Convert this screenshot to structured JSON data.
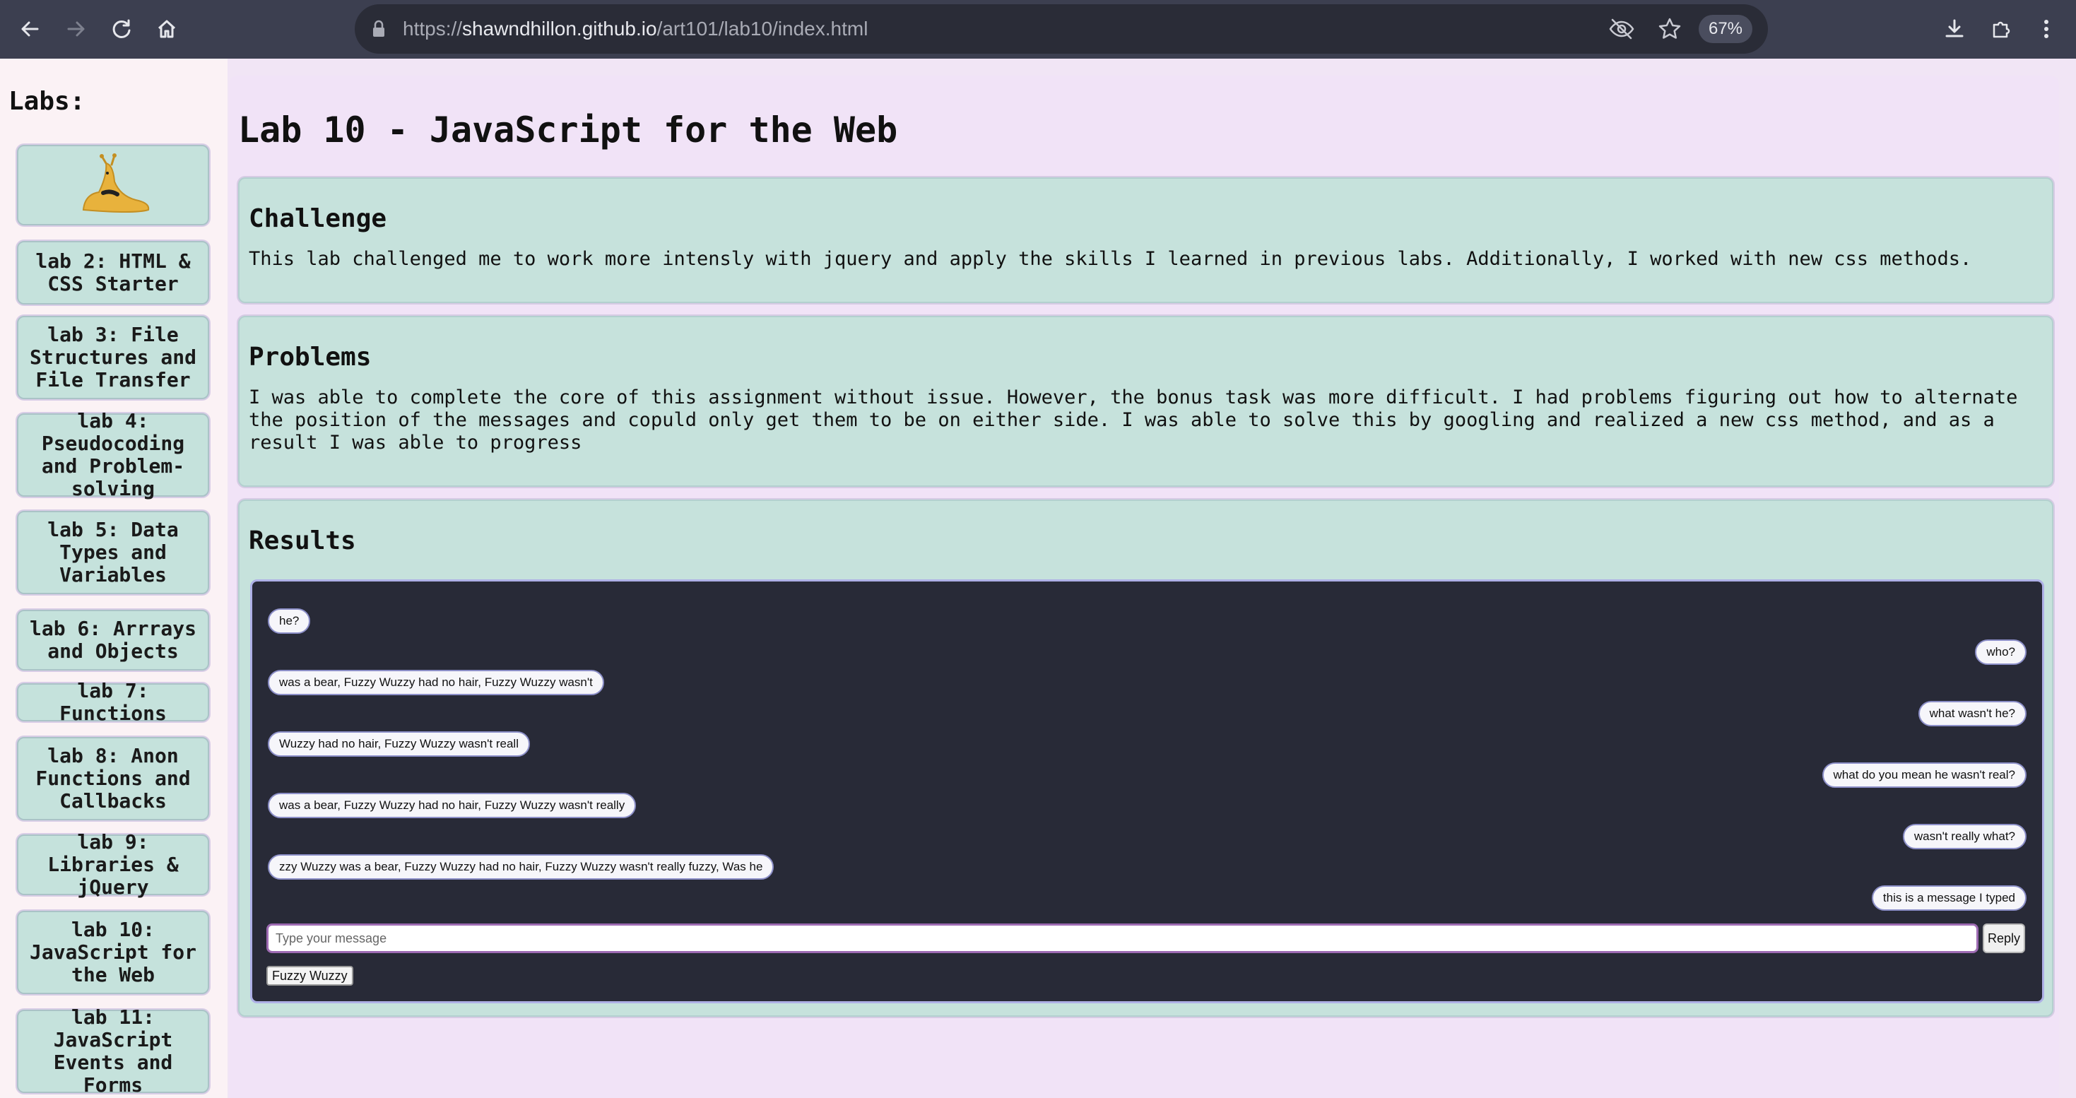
{
  "browser": {
    "url_scheme": "https://",
    "url_host": "shawndhillon.github.io",
    "url_path": "/art101/lab10/index.html",
    "zoom": "67%"
  },
  "sidebar": {
    "title": "Labs:",
    "items": [
      {
        "label": "",
        "icon": "banana-slug-mascot"
      },
      {
        "label": "lab 2: HTML & CSS Starter"
      },
      {
        "label": "lab 3: File Structures and File Transfer"
      },
      {
        "label": "lab 4: Pseudocoding and Problem-solving"
      },
      {
        "label": "lab 5: Data Types and Variables"
      },
      {
        "label": "lab 6: Arrrays and Objects"
      },
      {
        "label": "lab 7: Functions"
      },
      {
        "label": "lab 8: Anon Functions and Callbacks"
      },
      {
        "label": "lab 9: Libraries & jQuery"
      },
      {
        "label": "lab 10: JavaScript for the Web"
      },
      {
        "label": "lab 11: JavaScript Events and Forms"
      }
    ]
  },
  "main": {
    "title": "Lab 10 - JavaScript for the Web",
    "challenge": {
      "heading": "Challenge",
      "text": "This lab challenged me to work more intensly with jquery and apply the skills I learned in previous labs. Additionally, I worked with new css methods."
    },
    "problems": {
      "heading": "Problems",
      "text": "I was able to complete the core of this assignment without issue. However, the bonus task was more difficult. I had problems figuring out how to alternate the position of the messages and copuld only get them to be on either side. I was able to solve this by googling and realized a new css method, and as a result I was able to progress"
    },
    "results": {
      "heading": "Results",
      "messages": [
        {
          "side": "left",
          "text": "he?"
        },
        {
          "side": "right",
          "text": "who?"
        },
        {
          "side": "left",
          "text": "was a bear, Fuzzy Wuzzy had no hair, Fuzzy Wuzzy wasn't"
        },
        {
          "side": "right",
          "text": "what wasn't he?"
        },
        {
          "side": "left",
          "text": "Wuzzy had no hair, Fuzzy Wuzzy wasn't reall"
        },
        {
          "side": "right",
          "text": "what do you mean he wasn't real?"
        },
        {
          "side": "left",
          "text": "was a bear, Fuzzy Wuzzy had no hair, Fuzzy Wuzzy wasn't really"
        },
        {
          "side": "right",
          "text": "wasn't really what?"
        },
        {
          "side": "left",
          "text": "zzy Wuzzy was a bear, Fuzzy Wuzzy had no hair, Fuzzy Wuzzy wasn't really fuzzy, Was he"
        },
        {
          "side": "right",
          "text": "this is a message I typed"
        }
      ],
      "input_placeholder": "Type your message",
      "reply_label": "Reply",
      "name_label": "Fuzzy Wuzzy"
    }
  }
}
